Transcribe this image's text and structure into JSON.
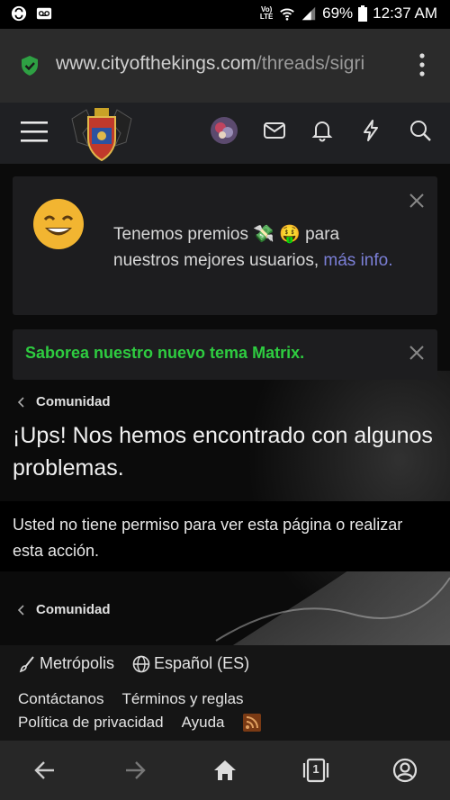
{
  "status_bar": {
    "network_label": "Vo) LTE",
    "battery": "69%",
    "time": "12:37 AM",
    "icons": [
      "sync-icon",
      "voicemail-icon",
      "wifi-icon",
      "signal-icon",
      "battery-icon"
    ]
  },
  "browser": {
    "url_host": "www.cityofthekings.com",
    "url_path": "/threads/sigri",
    "secure_icon": "shield-check-icon",
    "menu_icon": "more-vert-icon"
  },
  "site_header": {
    "icons": [
      "hamburger-icon",
      "site-logo",
      "avatar",
      "envelope-icon",
      "bell-icon",
      "bolt-icon",
      "search-icon"
    ]
  },
  "notices": {
    "promo": {
      "text": "Tenemos premios 💸 🤑 para nuestros mejores usuarios, ",
      "link": "más info."
    },
    "theme": {
      "text": "Saborea nuestro nuevo tema Matrix."
    }
  },
  "breadcrumb": {
    "top": "Comunidad",
    "bottom": "Comunidad"
  },
  "page": {
    "title": "¡Ups! Nos hemos encontrado con algunos problemas.",
    "message": "Usted no tiene permiso para ver esta página o realizar esta acción."
  },
  "footer": {
    "style_chooser": "Metrópolis",
    "language": "Español (ES)",
    "links_row1": [
      "Contáctanos",
      "Términos y reglas"
    ],
    "links_row2": [
      "Política de privacidad",
      "Ayuda"
    ]
  },
  "nav_bar": {
    "tab_count": "1",
    "icons": [
      "back-arrow-icon",
      "forward-arrow-icon",
      "home-icon",
      "tabs-icon",
      "account-icon"
    ]
  },
  "colors": {
    "theme_notice_text": "#2ecc40",
    "link": "#7b7fd6",
    "header_bg": "#1f2023",
    "urlbar_bg": "#2b2b2b"
  }
}
